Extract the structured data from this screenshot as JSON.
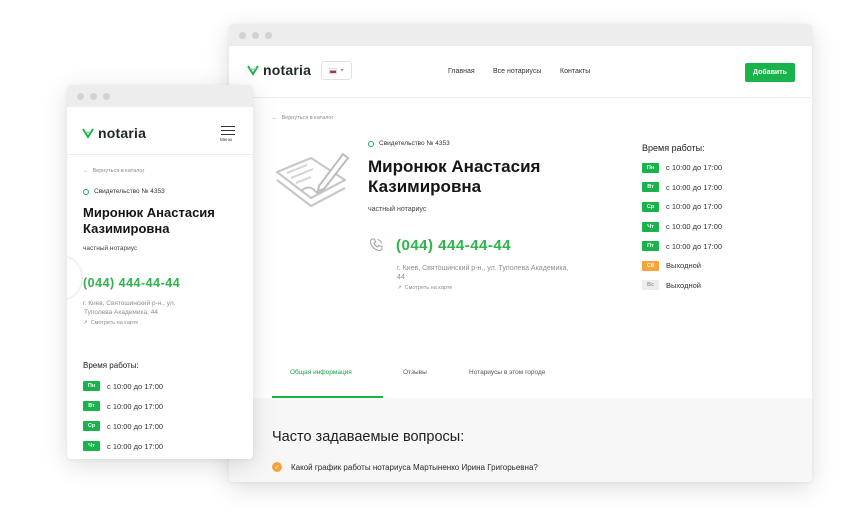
{
  "brand": {
    "name": "notaria",
    "accent": "#18b34b",
    "phone_color": "#2db44a"
  },
  "desktop": {
    "lang": "RU",
    "nav": [
      {
        "label": "Главная"
      },
      {
        "label": "Все нотариусы"
      },
      {
        "label": "Контакты"
      }
    ],
    "add_button": "Добавить"
  },
  "mobile": {
    "menu_label": "Меню"
  },
  "profile": {
    "back": "Вернуться в каталог",
    "certificate": "Свидетельство № 4353",
    "name_line1": "Миронюк Анастасия",
    "name_line2": "Казимировна",
    "role": "частный нотариус",
    "phone": "(044) 444-44-44",
    "address_line1": "г. Киев, Святошинский р-н., ул. Туполева Академика,",
    "address_line2": "44",
    "mobile_address_line1": "г. Киев, Святошинский р-н., ул.",
    "mobile_address_line2": "Туполева Академика, 44",
    "map_link": "Смотреть на карте",
    "hours_title": "Время работы:",
    "hours": [
      {
        "day": "Пн",
        "text": "с 10:00 до 17:00",
        "color": "#18b34b",
        "text_color": "#ffffff"
      },
      {
        "day": "Вт",
        "text": "с 10:00 до 17:00",
        "color": "#18b34b",
        "text_color": "#ffffff"
      },
      {
        "day": "Ср",
        "text": "с 10:00 до 17:00",
        "color": "#18b34b",
        "text_color": "#ffffff"
      },
      {
        "day": "Чт",
        "text": "с 10:00 до 17:00",
        "color": "#18b34b",
        "text_color": "#ffffff"
      },
      {
        "day": "Пт",
        "text": "с 10:00 до 17:00",
        "color": "#18b34b",
        "text_color": "#ffffff"
      },
      {
        "day": "Сб",
        "text": "Выходной",
        "color": "#f5a33c",
        "text_color": "#ffffff"
      },
      {
        "day": "Вс",
        "text": "Выходной",
        "color": "#ececec",
        "text_color": "#9a9a9a"
      }
    ]
  },
  "tabs": [
    {
      "label": "Общая информация",
      "active": true
    },
    {
      "label": "Отзывы",
      "active": false
    },
    {
      "label": "Нотариусы в этом городе",
      "active": false
    }
  ],
  "faq": {
    "title": "Часто задаваемые вопросы:",
    "items": [
      {
        "question": "Какой график работы нотариуса Мартыненко Ирина Григорьевна?"
      }
    ]
  },
  "icons": [
    "leaf-logo-icon",
    "flag-icon",
    "chevron-down-icon",
    "arrow-left-icon",
    "document-sign-icon",
    "phone-icon",
    "external-link-icon",
    "question-icon",
    "menu-icon"
  ]
}
